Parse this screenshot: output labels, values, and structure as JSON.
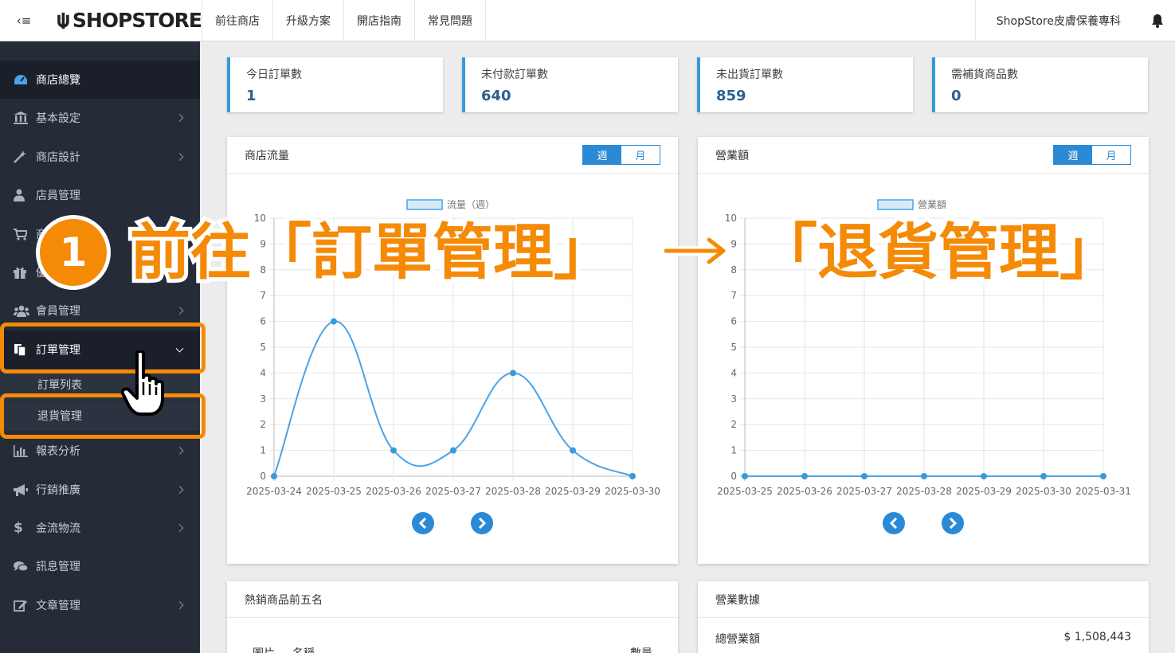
{
  "header": {
    "logo_text": "SHOPSTORE",
    "nav": [
      "前往商店",
      "升級方案",
      "開店指南",
      "常見問題"
    ],
    "shop_name": "ShopStore皮膚保養專科"
  },
  "sidebar": {
    "items": [
      {
        "label": "商店總覽",
        "icon": "dashboard-icon"
      },
      {
        "label": "基本設定",
        "icon": "bank-icon"
      },
      {
        "label": "商店設計",
        "icon": "magic-wand-icon"
      },
      {
        "label": "店員管理",
        "icon": "user-tie-icon"
      },
      {
        "label": "商品管理",
        "icon": "cart-icon"
      },
      {
        "label": "優惠活動",
        "icon": "gift-icon"
      },
      {
        "label": "會員管理",
        "icon": "users-icon"
      },
      {
        "label": "訂單管理",
        "icon": "copy-icon"
      },
      {
        "label": "報表分析",
        "icon": "bar-chart-icon"
      },
      {
        "label": "行銷推廣",
        "icon": "bullhorn-icon"
      },
      {
        "label": "金流物流",
        "icon": "dollar-icon"
      },
      {
        "label": "訊息管理",
        "icon": "comments-icon"
      },
      {
        "label": "文章管理",
        "icon": "edit-icon"
      }
    ],
    "sub_items": [
      "訂單列表",
      "退貨管理"
    ]
  },
  "stats": [
    {
      "label": "今日訂單數",
      "value": "1"
    },
    {
      "label": "未付款訂單數",
      "value": "640"
    },
    {
      "label": "未出貨訂單數",
      "value": "859"
    },
    {
      "label": "需補貨商品數",
      "value": "0"
    }
  ],
  "traffic_panel": {
    "title": "商店流量",
    "seg_week": "週",
    "seg_month": "月"
  },
  "revenue_panel": {
    "title": "營業額",
    "seg_week": "週",
    "seg_month": "月"
  },
  "hot_panel": {
    "title": "熱銷商品前五名",
    "col_image": "圖片",
    "col_name": "名稱",
    "col_qty": "數量"
  },
  "stats_panel": {
    "title": "營業數據",
    "total_label": "總營業額",
    "total_value": "$ 1,508,443"
  },
  "overlay": {
    "step": "1",
    "text_a": "前往「訂單管理」",
    "arrow": "→",
    "text_b": "「退貨管理」"
  },
  "colors": {
    "accent": "#2b8ad6",
    "highlight": "#f58a07",
    "sidebar": "#252b37"
  },
  "chart_data": [
    {
      "type": "line",
      "legend": "流量（週）",
      "x": [
        "2025-03-24",
        "2025-03-25",
        "2025-03-26",
        "2025-03-27",
        "2025-03-28",
        "2025-03-29",
        "2025-03-30"
      ],
      "values": [
        0,
        6,
        1,
        1,
        4,
        1,
        0
      ],
      "ylim": [
        0,
        10
      ],
      "yticks": [
        0,
        1,
        2,
        3,
        4,
        5,
        6,
        7,
        8,
        9,
        10
      ]
    },
    {
      "type": "line",
      "legend": "營業額",
      "x": [
        "2025-03-25",
        "2025-03-26",
        "2025-03-27",
        "2025-03-28",
        "2025-03-29",
        "2025-03-30",
        "2025-03-31"
      ],
      "values": [
        0,
        0,
        0,
        0,
        0,
        0,
        0
      ],
      "ylim": [
        0,
        10
      ],
      "yticks": [
        0,
        1,
        2,
        3,
        4,
        5,
        6,
        7,
        8,
        9,
        10
      ]
    }
  ]
}
